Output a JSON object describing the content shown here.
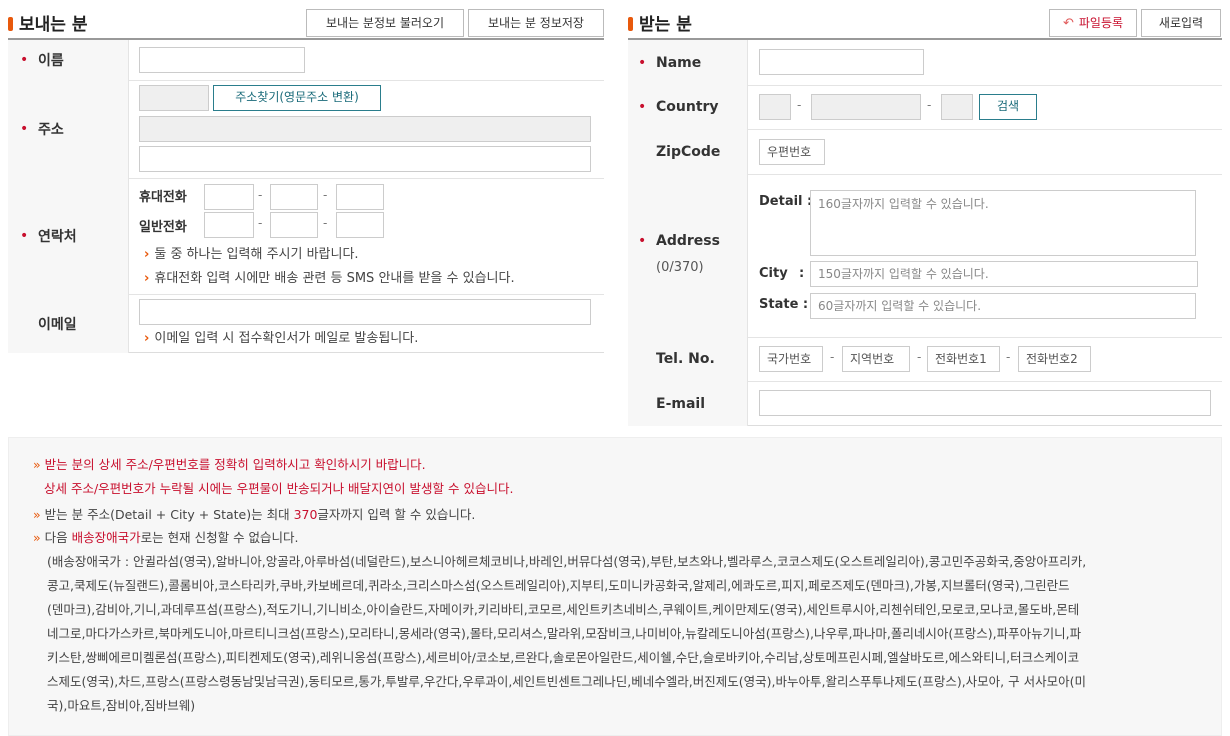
{
  "sender": {
    "title": "보내는 분",
    "load_button": "보내는 분정보 불러오기",
    "save_button": "보내는 분 정보저장",
    "name_label": "이름",
    "address_label": "주소",
    "address_search_button": "주소찾기(영문주소 변환)",
    "contact_label": "연락처",
    "mobile_label": "휴대전화",
    "phone_label": "일반전화",
    "dash": "-",
    "contact_guide_1": "둘 중 하나는 입력해 주시기 바랍니다.",
    "contact_guide_2": "휴대전화 입력 시에만 배송 관련 등 SMS 안내를 받을 수 있습니다.",
    "email_label": "이메일",
    "email_guide": "이메일 입력 시 접수확인서가 메일로 발송됩니다."
  },
  "receiver": {
    "title": "받는 분",
    "file_button": "파일등록",
    "new_button": "새로입력",
    "name_label": "Name",
    "country_label": "Country",
    "search_button": "검색",
    "zipcode_label": "ZipCode",
    "zipcode_placeholder": "우편번호",
    "address_label": "Address",
    "address_count": "(0/370)",
    "detail_label": "Detail :",
    "detail_placeholder": "160글자까지 입력할 수 있습니다.",
    "city_label": "City",
    "colon": ":",
    "city_placeholder": "150글자까지 입력할 수 있습니다.",
    "state_label": "State :",
    "state_placeholder": "60글자까지 입력할 수 있습니다.",
    "tel_label": "Tel. No.",
    "tel_country": "국가번호",
    "tel_area": "지역번호",
    "tel_phone1": "전화번호1",
    "tel_phone2": "전화번호2",
    "email_label": "E-mail"
  },
  "notice": {
    "line1": "받는 분의 상세 주소/우편번호를 정확히 입력하시고 확인하시기 바랍니다.",
    "line2": "상세 주소/우편번호가 누락될 시에는 우편물이 반송되거나 배달지연이 발생할 수 있습니다.",
    "line3_a": "받는 분 주소(Detail + City + State)는 최대 ",
    "line3_num": "370",
    "line3_b": "글자까지 입력 할 수 있습니다.",
    "line4_a": "다음 ",
    "line4_red": "배송장애국가",
    "line4_b": "로는 현재 신청할 수 없습니다.",
    "countries": [
      "(배송장애국가 : 안귈라섬(영국),알바니아,앙골라,아루바섬(네덜란드),보스니아헤르체코비나,바레인,버뮤다섬(영국),부탄,보츠와나,벨라루스,코코스제도(오스트레일리아),콩고민주공화국,중앙아프리카,",
      "콩고,쿡제도(뉴질랜드),콜롬비아,코스타리카,쿠바,카보베르데,퀴라소,크리스마스섬(오스트레일리아),지부티,도미니카공화국,알제리,에콰도르,피지,페로즈제도(덴마크),가봉,지브롤터(영국),그린란드",
      "(덴마크),감비아,기니,과데루프섬(프랑스),적도기니,기니비소,아이슬란드,자메이카,키리바티,코모르,세인트키츠네비스,쿠웨이트,케이만제도(영국),세인트루시아,리첸쉬테인,모로코,모나코,몰도바,몬테",
      "네그로,마다가스카르,북마케도니아,마르티니크섬(프랑스),모리타니,몽세라(영국),몰타,모리셔스,말라위,모잠비크,나미비아,뉴칼레도니아섬(프랑스),나우루,파나마,폴리네시아(프랑스),파푸아뉴기니,파",
      "키스탄,쌍삐에르미켈론섬(프랑스),피티켄제도(영국),레위니옹섬(프랑스),세르비아/코소보,르완다,솔로몬아일란드,세이쉘,수단,슬로바키아,수리남,상토메프린시페,엘살바도르,에스와티니,터크스케이코",
      "스제도(영국),차드,프랑스(프랑스령동남및남극권),동티모르,통가,투발루,우간다,우루과이,세인트빈센트그레나딘,베네수엘라,버진제도(영국),바누아투,왈리스푸투나제도(프랑스),사모아, 구 서사모아(미",
      "국),마요트,잠비아,짐바브웨)"
    ]
  },
  "colors": {
    "accent": "#e8590c",
    "required": "#c8102e",
    "teal": "#2a7d8c"
  }
}
